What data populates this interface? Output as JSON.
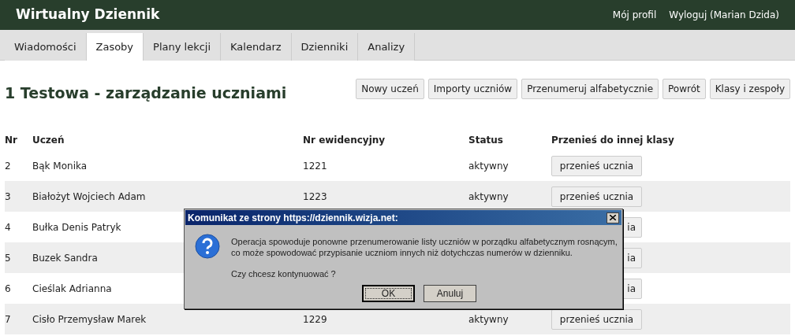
{
  "header": {
    "title": "Wirtualny Dziennik",
    "links": [
      "Mój profil",
      "Wyloguj (Marian Dzida)"
    ]
  },
  "tabs": [
    {
      "label": "Wiadomości",
      "selected": false
    },
    {
      "label": "Zasoby",
      "selected": true
    },
    {
      "label": "Plany lekcji",
      "selected": false
    },
    {
      "label": "Kalendarz",
      "selected": false
    },
    {
      "label": "Dzienniki",
      "selected": false
    },
    {
      "label": "Analizy",
      "selected": false
    }
  ],
  "page_title": "1 Testowa - zarządzanie uczniami",
  "actions": [
    "Nowy uczeń",
    "Importy uczniów",
    "Przenumeruj alfabetycznie",
    "Powrót",
    "Klasy i zespoły"
  ],
  "table": {
    "columns": [
      "Nr",
      "Uczeń",
      "Nr ewidencyjny",
      "Status",
      "Przenieś do innej klasy"
    ],
    "rows": [
      {
        "nr": "2",
        "name": "Bąk Monika",
        "id": "1221",
        "status": "aktywny",
        "action": "przenieś ucznia"
      },
      {
        "nr": "3",
        "name": "Białożyt Wojciech Adam",
        "id": "1223",
        "status": "aktywny",
        "action": "przenieś ucznia"
      },
      {
        "nr": "4",
        "name": "Bułka Denis Patryk",
        "action": "ia"
      },
      {
        "nr": "5",
        "name": "Buzek Sandra",
        "action": "ia"
      },
      {
        "nr": "6",
        "name": "Cieślak Adrianna",
        "action": "ia"
      },
      {
        "nr": "7",
        "name": "Cisło Przemysław Marek",
        "id": "1229",
        "status": "aktywny",
        "action": "przenieś ucznia"
      }
    ]
  },
  "dialog": {
    "title": "Komunikat ze strony https://dziennik.wizja.net:",
    "message": "Operacja spowoduje ponowne przenumerowanie listy uczniów w porządku alfabetycznym rosnącym, co może spowodować przypisanie uczniom innych niż dotychczas numerów w dzienniku.",
    "question": "Czy chcesz kontynuować ?",
    "buttons": [
      {
        "label": "OK",
        "default": true
      },
      {
        "label": "Anuluj",
        "default": false
      }
    ]
  }
}
